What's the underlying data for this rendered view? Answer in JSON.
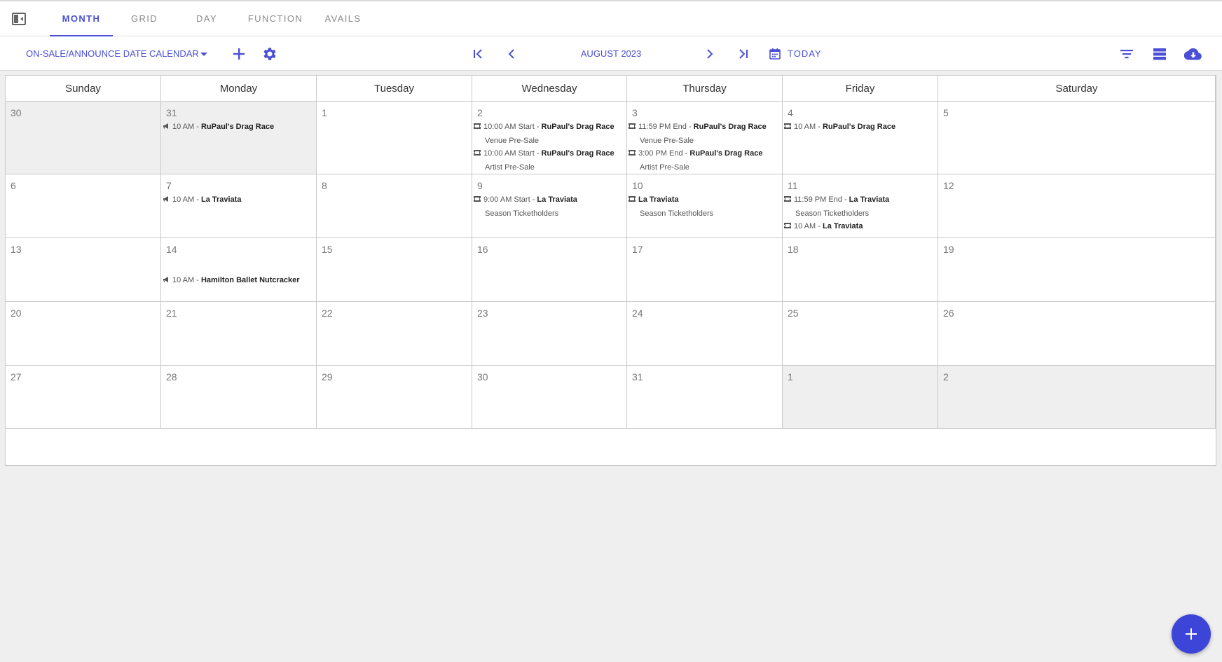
{
  "tabs": [
    {
      "label": "MONTH",
      "active": true
    },
    {
      "label": "GRID",
      "active": false
    },
    {
      "label": "DAY",
      "active": false
    },
    {
      "label": "FUNCTION",
      "active": false
    },
    {
      "label": "AVAILS",
      "active": false
    }
  ],
  "toolbar": {
    "calendar_select": "ON-SALE/ANNOUNCE DATE CALENDAR",
    "month_label": "AUGUST 2023",
    "today_label": "TODAY"
  },
  "colors": {
    "accent": "#4b4fd6",
    "fab": "#3d44d8",
    "muted_cell": "#efefef"
  },
  "weekdays": [
    "Sunday",
    "Monday",
    "Tuesday",
    "Wednesday",
    "Thursday",
    "Friday",
    "Saturday"
  ],
  "weeks": [
    [
      {
        "day": "30",
        "muted": true,
        "events": []
      },
      {
        "day": "31",
        "muted": true,
        "events": [
          {
            "icon": "megaphone",
            "time": "10 AM - ",
            "name": "RuPaul's Drag Race"
          }
        ]
      },
      {
        "day": "1",
        "events": []
      },
      {
        "day": "2",
        "events": [
          {
            "icon": "ticket",
            "time": "10:00 AM Start - ",
            "name": "RuPaul's Drag Race",
            "sub": "Venue Pre-Sale"
          },
          {
            "icon": "ticket",
            "time": "10:00 AM Start - ",
            "name": "RuPaul's Drag Race",
            "sub": "Artist Pre-Sale"
          }
        ]
      },
      {
        "day": "3",
        "events": [
          {
            "icon": "ticket",
            "time": "11:59 PM End - ",
            "name": "RuPaul's Drag Race",
            "sub": "Venue Pre-Sale"
          },
          {
            "icon": "ticket",
            "time": "3:00 PM End - ",
            "name": "RuPaul's Drag Race",
            "sub": "Artist Pre-Sale"
          }
        ]
      },
      {
        "day": "4",
        "events": [
          {
            "icon": "ticket",
            "time": "10 AM - ",
            "name": "RuPaul's Drag Race"
          }
        ]
      },
      {
        "day": "5",
        "events": []
      }
    ],
    [
      {
        "day": "6",
        "events": []
      },
      {
        "day": "7",
        "events": [
          {
            "icon": "megaphone",
            "time": "10 AM - ",
            "name": "La Traviata"
          }
        ]
      },
      {
        "day": "8",
        "events": []
      },
      {
        "day": "9",
        "events": [
          {
            "icon": "ticket",
            "time": "9:00 AM Start - ",
            "name": "La Traviata",
            "sub": "Season Ticketholders"
          }
        ]
      },
      {
        "day": "10",
        "events": [
          {
            "icon": "ticket",
            "time": "",
            "name": "La Traviata",
            "sub": "Season Ticketholders"
          }
        ]
      },
      {
        "day": "11",
        "events": [
          {
            "icon": "ticket",
            "time": "11:59 PM End - ",
            "name": "La Traviata",
            "sub": "Season Ticketholders"
          },
          {
            "icon": "ticket",
            "time": "10 AM - ",
            "name": "La Traviata"
          }
        ]
      },
      {
        "day": "12",
        "events": []
      }
    ],
    [
      {
        "day": "13",
        "events": []
      },
      {
        "day": "14",
        "events": [
          {
            "icon": "megaphone",
            "time": "10 AM - ",
            "name": "Hamilton Ballet Nutcracker",
            "offset": 24
          }
        ]
      },
      {
        "day": "15",
        "events": []
      },
      {
        "day": "16",
        "events": []
      },
      {
        "day": "17",
        "events": []
      },
      {
        "day": "18",
        "events": []
      },
      {
        "day": "19",
        "events": []
      }
    ],
    [
      {
        "day": "20",
        "events": []
      },
      {
        "day": "21",
        "events": []
      },
      {
        "day": "22",
        "events": []
      },
      {
        "day": "23",
        "events": []
      },
      {
        "day": "24",
        "events": []
      },
      {
        "day": "25",
        "events": []
      },
      {
        "day": "26",
        "events": []
      }
    ],
    [
      {
        "day": "27",
        "events": []
      },
      {
        "day": "28",
        "events": []
      },
      {
        "day": "29",
        "events": []
      },
      {
        "day": "30",
        "events": []
      },
      {
        "day": "31",
        "events": []
      },
      {
        "day": "1",
        "muted": true,
        "events": []
      },
      {
        "day": "2",
        "muted": true,
        "events": []
      }
    ]
  ]
}
